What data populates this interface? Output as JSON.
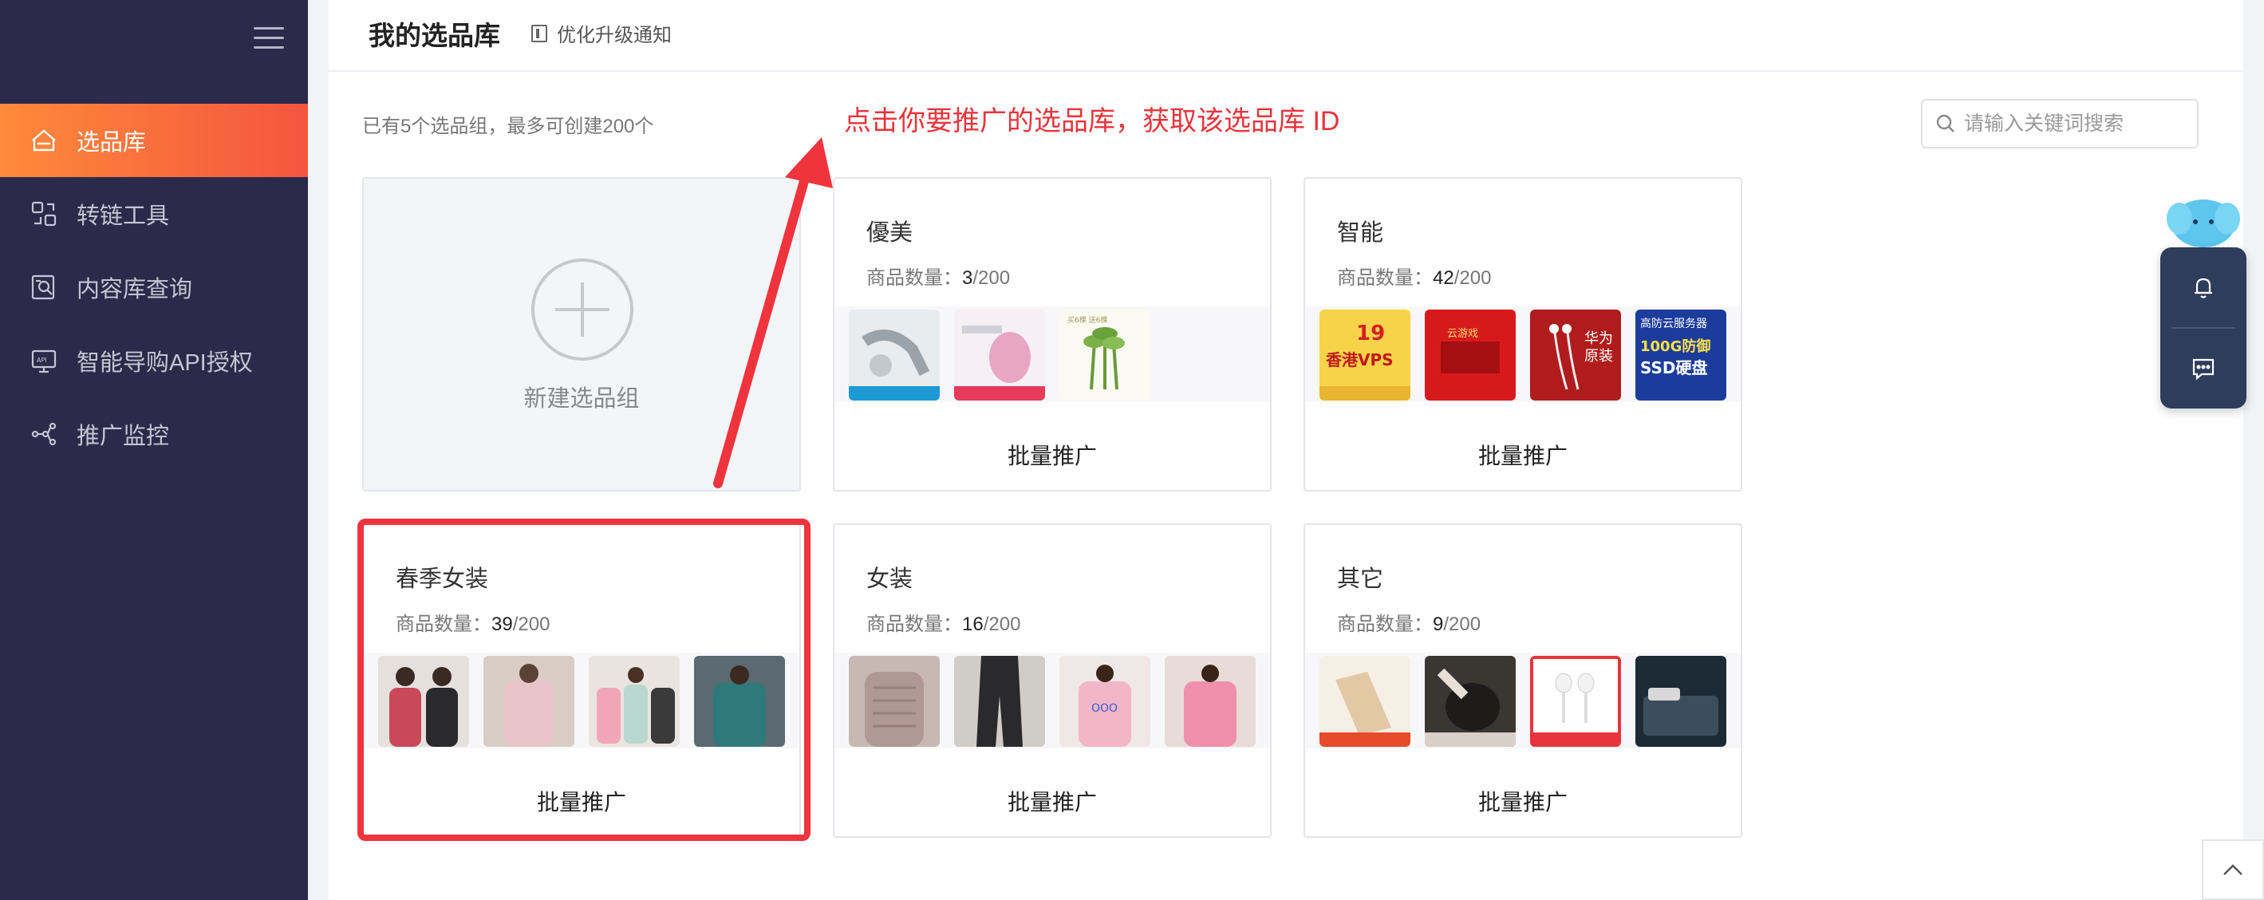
{
  "sidebar": {
    "items": [
      {
        "label": "选品库",
        "icon": "library-icon",
        "active": true
      },
      {
        "label": "转链工具",
        "icon": "link-tool-icon",
        "active": false
      },
      {
        "label": "内容库查询",
        "icon": "content-search-icon",
        "active": false
      },
      {
        "label": "智能导购API授权",
        "icon": "api-icon",
        "active": false
      },
      {
        "label": "推广监控",
        "icon": "monitor-icon",
        "active": false
      }
    ]
  },
  "header": {
    "title": "我的选品库",
    "notice": "优化升级通知"
  },
  "main": {
    "count_text": "已有5个选品组，最多可创建200个",
    "hint": "点击你要推广的选品库，获取该选品库 ID",
    "search": {
      "placeholder": "请输入关键词搜索",
      "value": ""
    },
    "new_group_label": "新建选品组",
    "count_label": "商品数量：",
    "max": "/200",
    "batch_label": "批量推广",
    "groups": [
      {
        "name": "優美",
        "count": "3"
      },
      {
        "name": "智能",
        "count": "42"
      },
      {
        "name": "春季女装",
        "count": "39"
      },
      {
        "name": "女装",
        "count": "16"
      },
      {
        "name": "其它",
        "count": "9"
      }
    ],
    "thumb_texts": {
      "vps": "香港VPS",
      "vps_price": "19",
      "server_title": "高防云服务器",
      "server_line2": "100G防御",
      "server_line3": "SSD硬盘",
      "huawei": "华为",
      "huawei2": "原装",
      "red_box": "云游戏",
      "plant": "买6棵 送6棵"
    }
  },
  "colors": {
    "sidebar_bg": "#2b2a4a",
    "active_from": "#ff8a3a",
    "active_to": "#f4553f",
    "hint_red": "#e8343c",
    "float_bg": "#2f3d5c"
  }
}
